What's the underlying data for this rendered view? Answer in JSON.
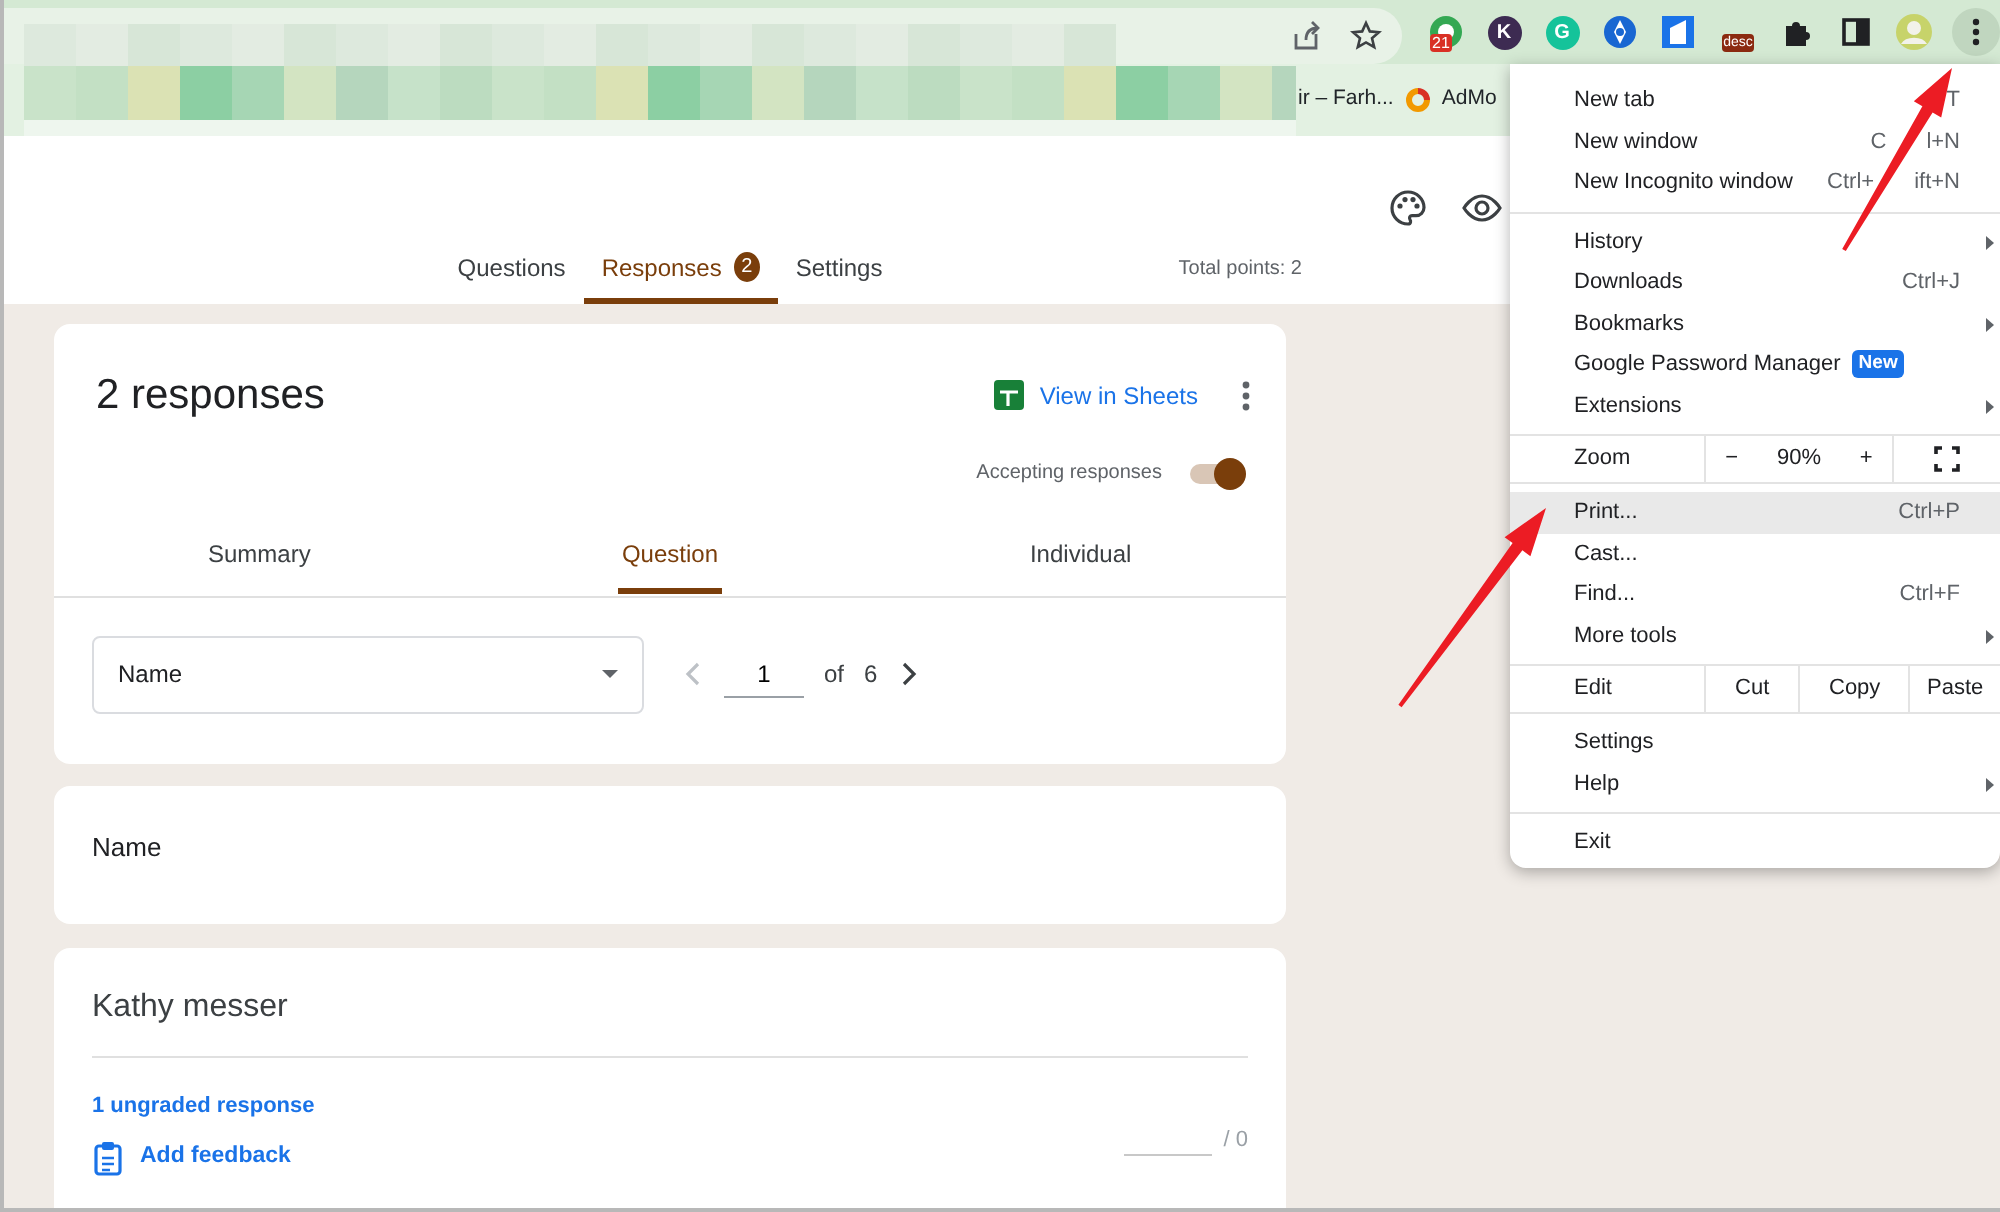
{
  "browser": {
    "extensions": [
      {
        "kind": "counter",
        "text": "21"
      },
      {
        "kind": "letter",
        "text": "K",
        "color": "#3d2b52"
      },
      {
        "kind": "letter",
        "text": "G",
        "color": "#15c39a"
      },
      {
        "kind": "compass"
      },
      {
        "kind": "square"
      },
      {
        "kind": "label",
        "text": "desc"
      },
      {
        "kind": "puzzle"
      },
      {
        "kind": "sidepanel"
      },
      {
        "kind": "avatar"
      }
    ],
    "bookmarks": [
      {
        "kind": "plain",
        "label": "ir – Farh..."
      },
      {
        "kind": "ring",
        "label": "AdMo"
      }
    ]
  },
  "form": {
    "tabs": [
      {
        "label": "Questions",
        "selected": false
      },
      {
        "label": "Responses",
        "badge": "2",
        "selected": true
      },
      {
        "label": "Settings",
        "selected": false
      }
    ],
    "total_points": "Total points: 2"
  },
  "summary_card": {
    "title": "2 responses",
    "sheets_link": "View in Sheets",
    "accepting": {
      "label": "Accepting responses",
      "on": true
    },
    "subtabs": [
      {
        "label": "Summary",
        "selected": false
      },
      {
        "label": "Question",
        "selected": true
      },
      {
        "label": "Individual",
        "selected": false
      }
    ],
    "question_select": {
      "value": "Name"
    },
    "pager": {
      "page": "1",
      "of": "of",
      "total": "6"
    }
  },
  "question_card": {
    "title": "Name"
  },
  "response_card": {
    "answer": "Kathy messer",
    "ungraded": "1 ungraded response",
    "feedback": "Add feedback",
    "score_max": "/ 0"
  },
  "menu": {
    "groups": [
      [
        {
          "kind": "item",
          "label": "New tab",
          "shortcut": [
            "T"
          ],
          "selected": false
        },
        {
          "kind": "item",
          "label": "New window",
          "shortcut": [
            "C",
            "l+N"
          ],
          "selected": false
        },
        {
          "kind": "item",
          "label": "New Incognito window",
          "shortcut": [
            "Ctrl+",
            "ift+N"
          ],
          "selected": false
        }
      ],
      [
        {
          "kind": "item",
          "label": "History",
          "submenu": true,
          "selected": false
        },
        {
          "kind": "item",
          "label": "Downloads",
          "shortcut": [
            "Ctrl+J"
          ],
          "selected": false
        },
        {
          "kind": "item",
          "label": "Bookmarks",
          "submenu": true,
          "selected": false
        },
        {
          "kind": "item",
          "label": "Google Password Manager",
          "badge": "New",
          "selected": false
        },
        {
          "kind": "item",
          "label": "Extensions",
          "submenu": true,
          "selected": false
        }
      ],
      [
        {
          "kind": "zoom",
          "label": "Zoom",
          "minus": "−",
          "value": "90%",
          "plus": "+"
        }
      ],
      [
        {
          "kind": "item",
          "label": "Print...",
          "shortcut": [
            "Ctrl+P"
          ],
          "selected": true
        },
        {
          "kind": "item",
          "label": "Cast...",
          "selected": false
        },
        {
          "kind": "item",
          "label": "Find...",
          "shortcut": [
            "Ctrl+F"
          ],
          "selected": false
        },
        {
          "kind": "item",
          "label": "More tools",
          "submenu": true,
          "selected": false
        }
      ],
      [
        {
          "kind": "edit",
          "label": "Edit",
          "actions": [
            "Cut",
            "Copy",
            "Paste"
          ]
        }
      ],
      [
        {
          "kind": "item",
          "label": "Settings",
          "selected": false
        },
        {
          "kind": "item",
          "label": "Help",
          "submenu": true,
          "selected": false
        }
      ],
      [
        {
          "kind": "item",
          "label": "Exit",
          "selected": false
        }
      ]
    ]
  }
}
